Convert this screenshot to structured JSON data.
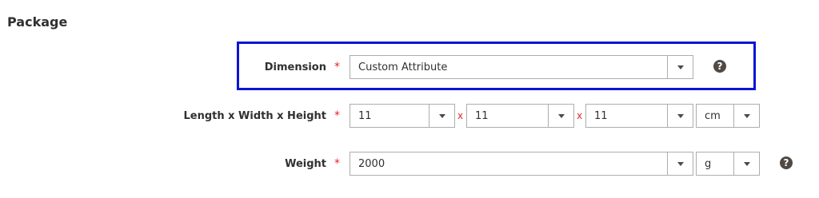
{
  "section": {
    "title": "Package"
  },
  "dimension": {
    "label": "Dimension",
    "required_mark": "*",
    "value": "Custom Attribute"
  },
  "size": {
    "label": "Length x Width x Height",
    "required_mark": "*",
    "length": "11",
    "width": "11",
    "height": "11",
    "separator": "x",
    "unit": "cm"
  },
  "weight": {
    "label": "Weight",
    "required_mark": "*",
    "value": "2000",
    "unit": "g"
  },
  "colors": {
    "highlight_border": "#0c14d4",
    "required": "#e22626"
  }
}
